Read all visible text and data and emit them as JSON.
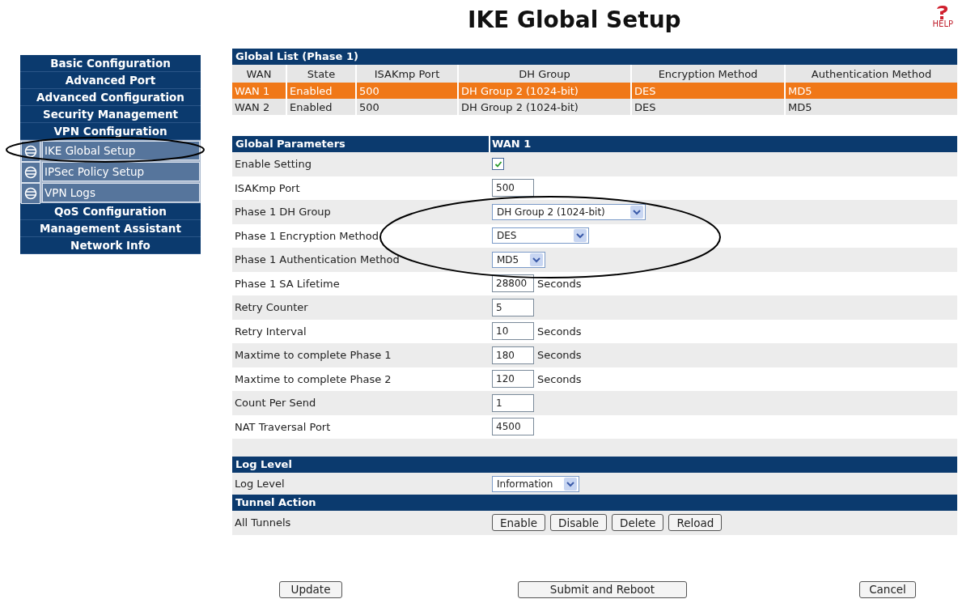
{
  "title": "IKE Global Setup",
  "help": {
    "label": "HELP"
  },
  "sidebar": [
    {
      "kind": "section",
      "label": "Basic Configuration"
    },
    {
      "kind": "section",
      "label": "Advanced Port"
    },
    {
      "kind": "section",
      "label": "Advanced Configuration"
    },
    {
      "kind": "section",
      "label": "Security Management"
    },
    {
      "kind": "section",
      "label": "VPN Configuration"
    },
    {
      "kind": "sub",
      "label": "IKE Global Setup"
    },
    {
      "kind": "sub",
      "label": "IPSec Policy Setup"
    },
    {
      "kind": "sub",
      "label": "VPN Logs"
    },
    {
      "kind": "section",
      "label": "QoS Configuration"
    },
    {
      "kind": "section",
      "label": "Management Assistant"
    },
    {
      "kind": "section",
      "label": "Network Info"
    }
  ],
  "global_list": {
    "title": "Global List (Phase 1)",
    "columns": [
      "WAN",
      "State",
      "ISAKmp Port",
      "DH Group",
      "Encryption Method",
      "Authentication Method"
    ],
    "rows": [
      {
        "selected": true,
        "cells": [
          "WAN 1",
          "Enabled",
          "500",
          "DH Group 2 (1024-bit)",
          "DES",
          "MD5"
        ]
      },
      {
        "selected": false,
        "cells": [
          "WAN 2",
          "Enabled",
          "500",
          "DH Group 2 (1024-bit)",
          "DES",
          "MD5"
        ]
      }
    ]
  },
  "parameters": {
    "title": "Global Parameters",
    "column": "WAN 1",
    "rows": [
      {
        "kind": "checkbox",
        "label": "Enable Setting",
        "checked": true
      },
      {
        "kind": "input",
        "label": "ISAKmp Port",
        "value": "500"
      },
      {
        "kind": "select",
        "label": "Phase 1 DH Group",
        "value": "DH Group 2 (1024-bit)"
      },
      {
        "kind": "select",
        "label": "Phase 1 Encryption Method",
        "value": "DES"
      },
      {
        "kind": "select",
        "label": "Phase 1 Authentication Method",
        "value": "MD5"
      },
      {
        "kind": "input",
        "label": "Phase 1 SA Lifetime",
        "value": "28800",
        "unit": "Seconds"
      },
      {
        "kind": "input",
        "label": "Retry Counter",
        "value": "5"
      },
      {
        "kind": "input",
        "label": "Retry Interval",
        "value": "10",
        "unit": "Seconds"
      },
      {
        "kind": "input",
        "label": "Maxtime to complete Phase 1",
        "value": "180",
        "unit": "Seconds"
      },
      {
        "kind": "input",
        "label": "Maxtime to complete Phase 2",
        "value": "120",
        "unit": "Seconds"
      },
      {
        "kind": "input",
        "label": "Count Per Send",
        "value": "1"
      },
      {
        "kind": "input",
        "label": "NAT Traversal Port",
        "value": "4500"
      }
    ]
  },
  "log_level": {
    "title": "Log Level",
    "label": "Log Level",
    "value": "Information"
  },
  "tunnel_action": {
    "title": "Tunnel Action",
    "label": "All Tunnels",
    "buttons": [
      "Enable",
      "Disable",
      "Delete",
      "Reload"
    ]
  },
  "footer_buttons": [
    "Update",
    "Submit and Reboot",
    "Cancel"
  ]
}
